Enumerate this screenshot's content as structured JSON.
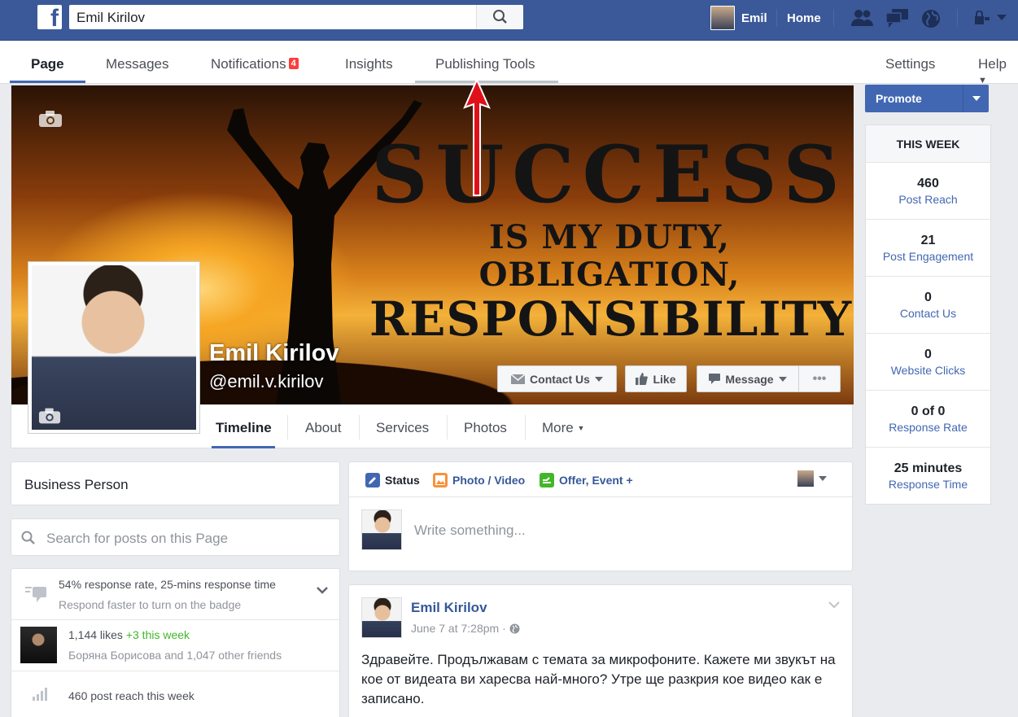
{
  "topbar": {
    "search_value": "Emil Kirilov",
    "user_name": "Emil",
    "home_label": "Home"
  },
  "page_tabs": [
    {
      "label": "Page"
    },
    {
      "label": "Messages"
    },
    {
      "label": "Notifications",
      "badge": "4"
    },
    {
      "label": "Insights"
    },
    {
      "label": "Publishing Tools"
    },
    {
      "label": "Settings"
    },
    {
      "label": "Help"
    }
  ],
  "cover": {
    "line1": "SUCCESS",
    "line2": "IS MY DUTY, OBLIGATION,",
    "line3": "RESPONSIBILITY"
  },
  "profile": {
    "name": "Emil Kirilov",
    "handle": "@emil.v.kirilov"
  },
  "cover_buttons": {
    "contact": "Contact Us",
    "like": "Like",
    "message": "Message",
    "more": "•••"
  },
  "subnav": [
    {
      "label": "Timeline"
    },
    {
      "label": "About"
    },
    {
      "label": "Services"
    },
    {
      "label": "Photos"
    },
    {
      "label": "More"
    }
  ],
  "left": {
    "category": "Business Person",
    "search_placeholder": "Search for posts on this Page",
    "response_line": "54% response rate, 25-mins response time",
    "response_sub": "Respond faster to turn on the badge",
    "likes_count": "1,144 likes",
    "likes_delta": "+3 this week",
    "likes_friends": "Боряна Борисова and 1,047 other friends",
    "reach_line": "460 post reach this week"
  },
  "composer": {
    "status": "Status",
    "photo_video": "Photo / Video",
    "offer_event": "Offer, Event +",
    "placeholder": "Write something..."
  },
  "post": {
    "author": "Emil Kirilov",
    "time": "June 7 at 7:28pm · ",
    "text": "Здравейте. Продължавам с темата за микрофоните. Кажете ми звукът на кое от видеата ви харесва най-много? Утре ще разкрия кое видео как е записано."
  },
  "right": {
    "promote": "Promote",
    "week_title": "THIS WEEK",
    "stats": [
      {
        "value": "460",
        "label": "Post Reach"
      },
      {
        "value": "21",
        "label": "Post Engagement"
      },
      {
        "value": "0",
        "label": "Contact Us"
      },
      {
        "value": "0",
        "label": "Website Clicks"
      },
      {
        "value": "0 of 0",
        "label": "Response Rate"
      },
      {
        "value": "25 minutes",
        "label": "Response Time"
      }
    ]
  },
  "colors": {
    "fb_blue": "#3b5998",
    "link_blue": "#365899",
    "annotation_red": "#e0101a",
    "badge_red": "#fa3e3e"
  }
}
